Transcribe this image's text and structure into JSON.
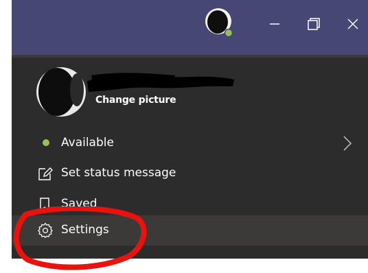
{
  "titlebar": {
    "avatar_icon": "user-avatar-with-presence",
    "presence_color": "#92c353",
    "minimize_icon": "minimize-icon",
    "restore_icon": "restore-icon",
    "close_icon": "close-icon",
    "background": "#464775"
  },
  "profile": {
    "name": "",
    "change_picture_label": "Change picture"
  },
  "menu": {
    "available_label": "Available",
    "status_message_label": "Set status message",
    "saved_label": "Saved",
    "settings_label": "Settings"
  },
  "colors": {
    "menu_background": "#2d2c2c",
    "hover_background": "#3b3a39",
    "available_green": "#92c353",
    "annotation_red": "#e8130f"
  }
}
